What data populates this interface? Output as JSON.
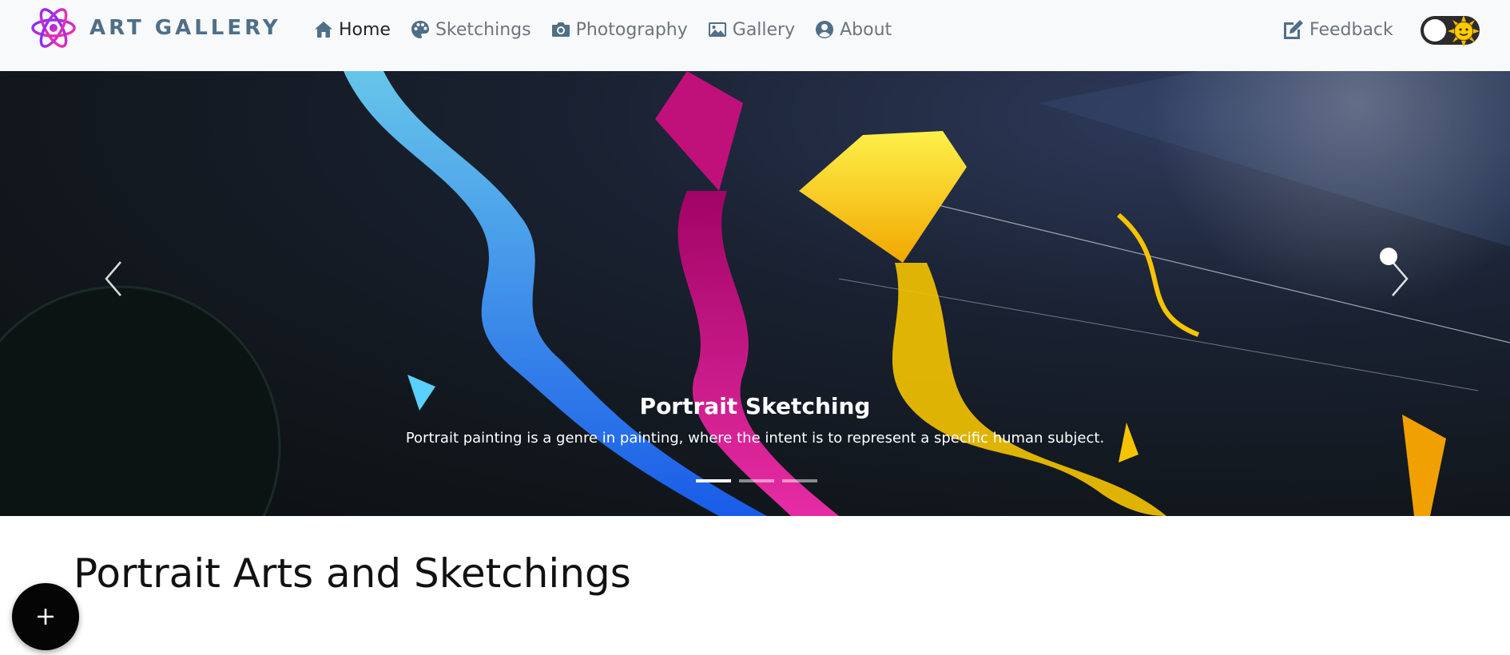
{
  "brand": {
    "name": "ART GALLERY",
    "logo_icon": "atom-icon"
  },
  "nav": {
    "items": [
      {
        "label": "Home",
        "icon": "home-icon",
        "active": true
      },
      {
        "label": "Sketchings",
        "icon": "palette-icon",
        "active": false
      },
      {
        "label": "Photography",
        "icon": "camera-icon",
        "active": false
      },
      {
        "label": "Gallery",
        "icon": "image-icon",
        "active": false
      },
      {
        "label": "About",
        "icon": "user-circle-icon",
        "active": false
      }
    ],
    "feedback": {
      "label": "Feedback",
      "icon": "edit-icon"
    },
    "theme_toggle": {
      "icon": "sun-icon",
      "state": "light"
    }
  },
  "carousel": {
    "caption_title": "Portrait Sketching",
    "caption_text": "Portrait painting is a genre in painting, where the intent is to represent a specific human subject.",
    "slide_count": 3,
    "active_slide": 1
  },
  "content": {
    "heading": "Portrait Arts and Sketchings"
  },
  "fab": {
    "icon": "plus-icon"
  },
  "colors": {
    "nav_bg": "#f8f9fa",
    "brand_text": "#4f6f87",
    "nav_text": "#6c757d",
    "nav_active": "#212529",
    "fab_bg": "#050505"
  }
}
